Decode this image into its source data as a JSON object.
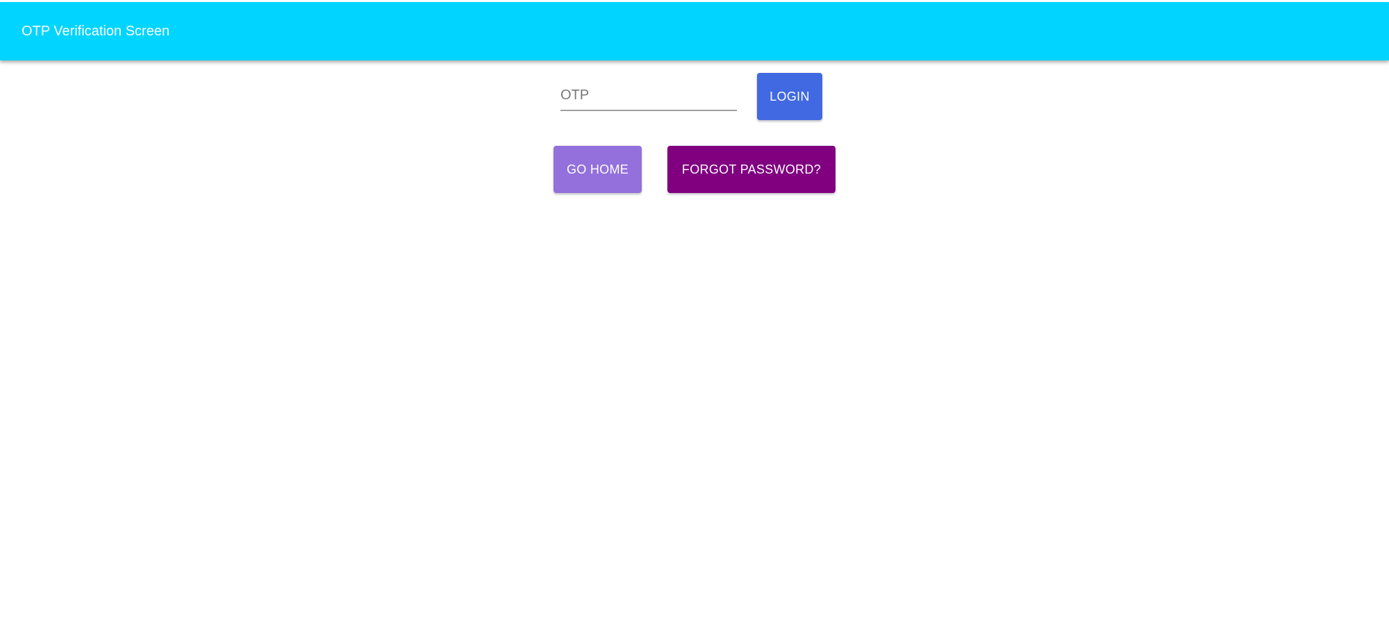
{
  "header": {
    "title": "OTP Verification Screen",
    "color": "#00d4ff"
  },
  "form": {
    "otp_placeholder": "OTP",
    "otp_value": "",
    "login_label": "LOGIN",
    "login_color": "#4169e1"
  },
  "actions": {
    "home_label": "GO HOME",
    "home_color": "#9370db",
    "forgot_label": "FORGOT PASSWORD?",
    "forgot_color": "#800080"
  }
}
